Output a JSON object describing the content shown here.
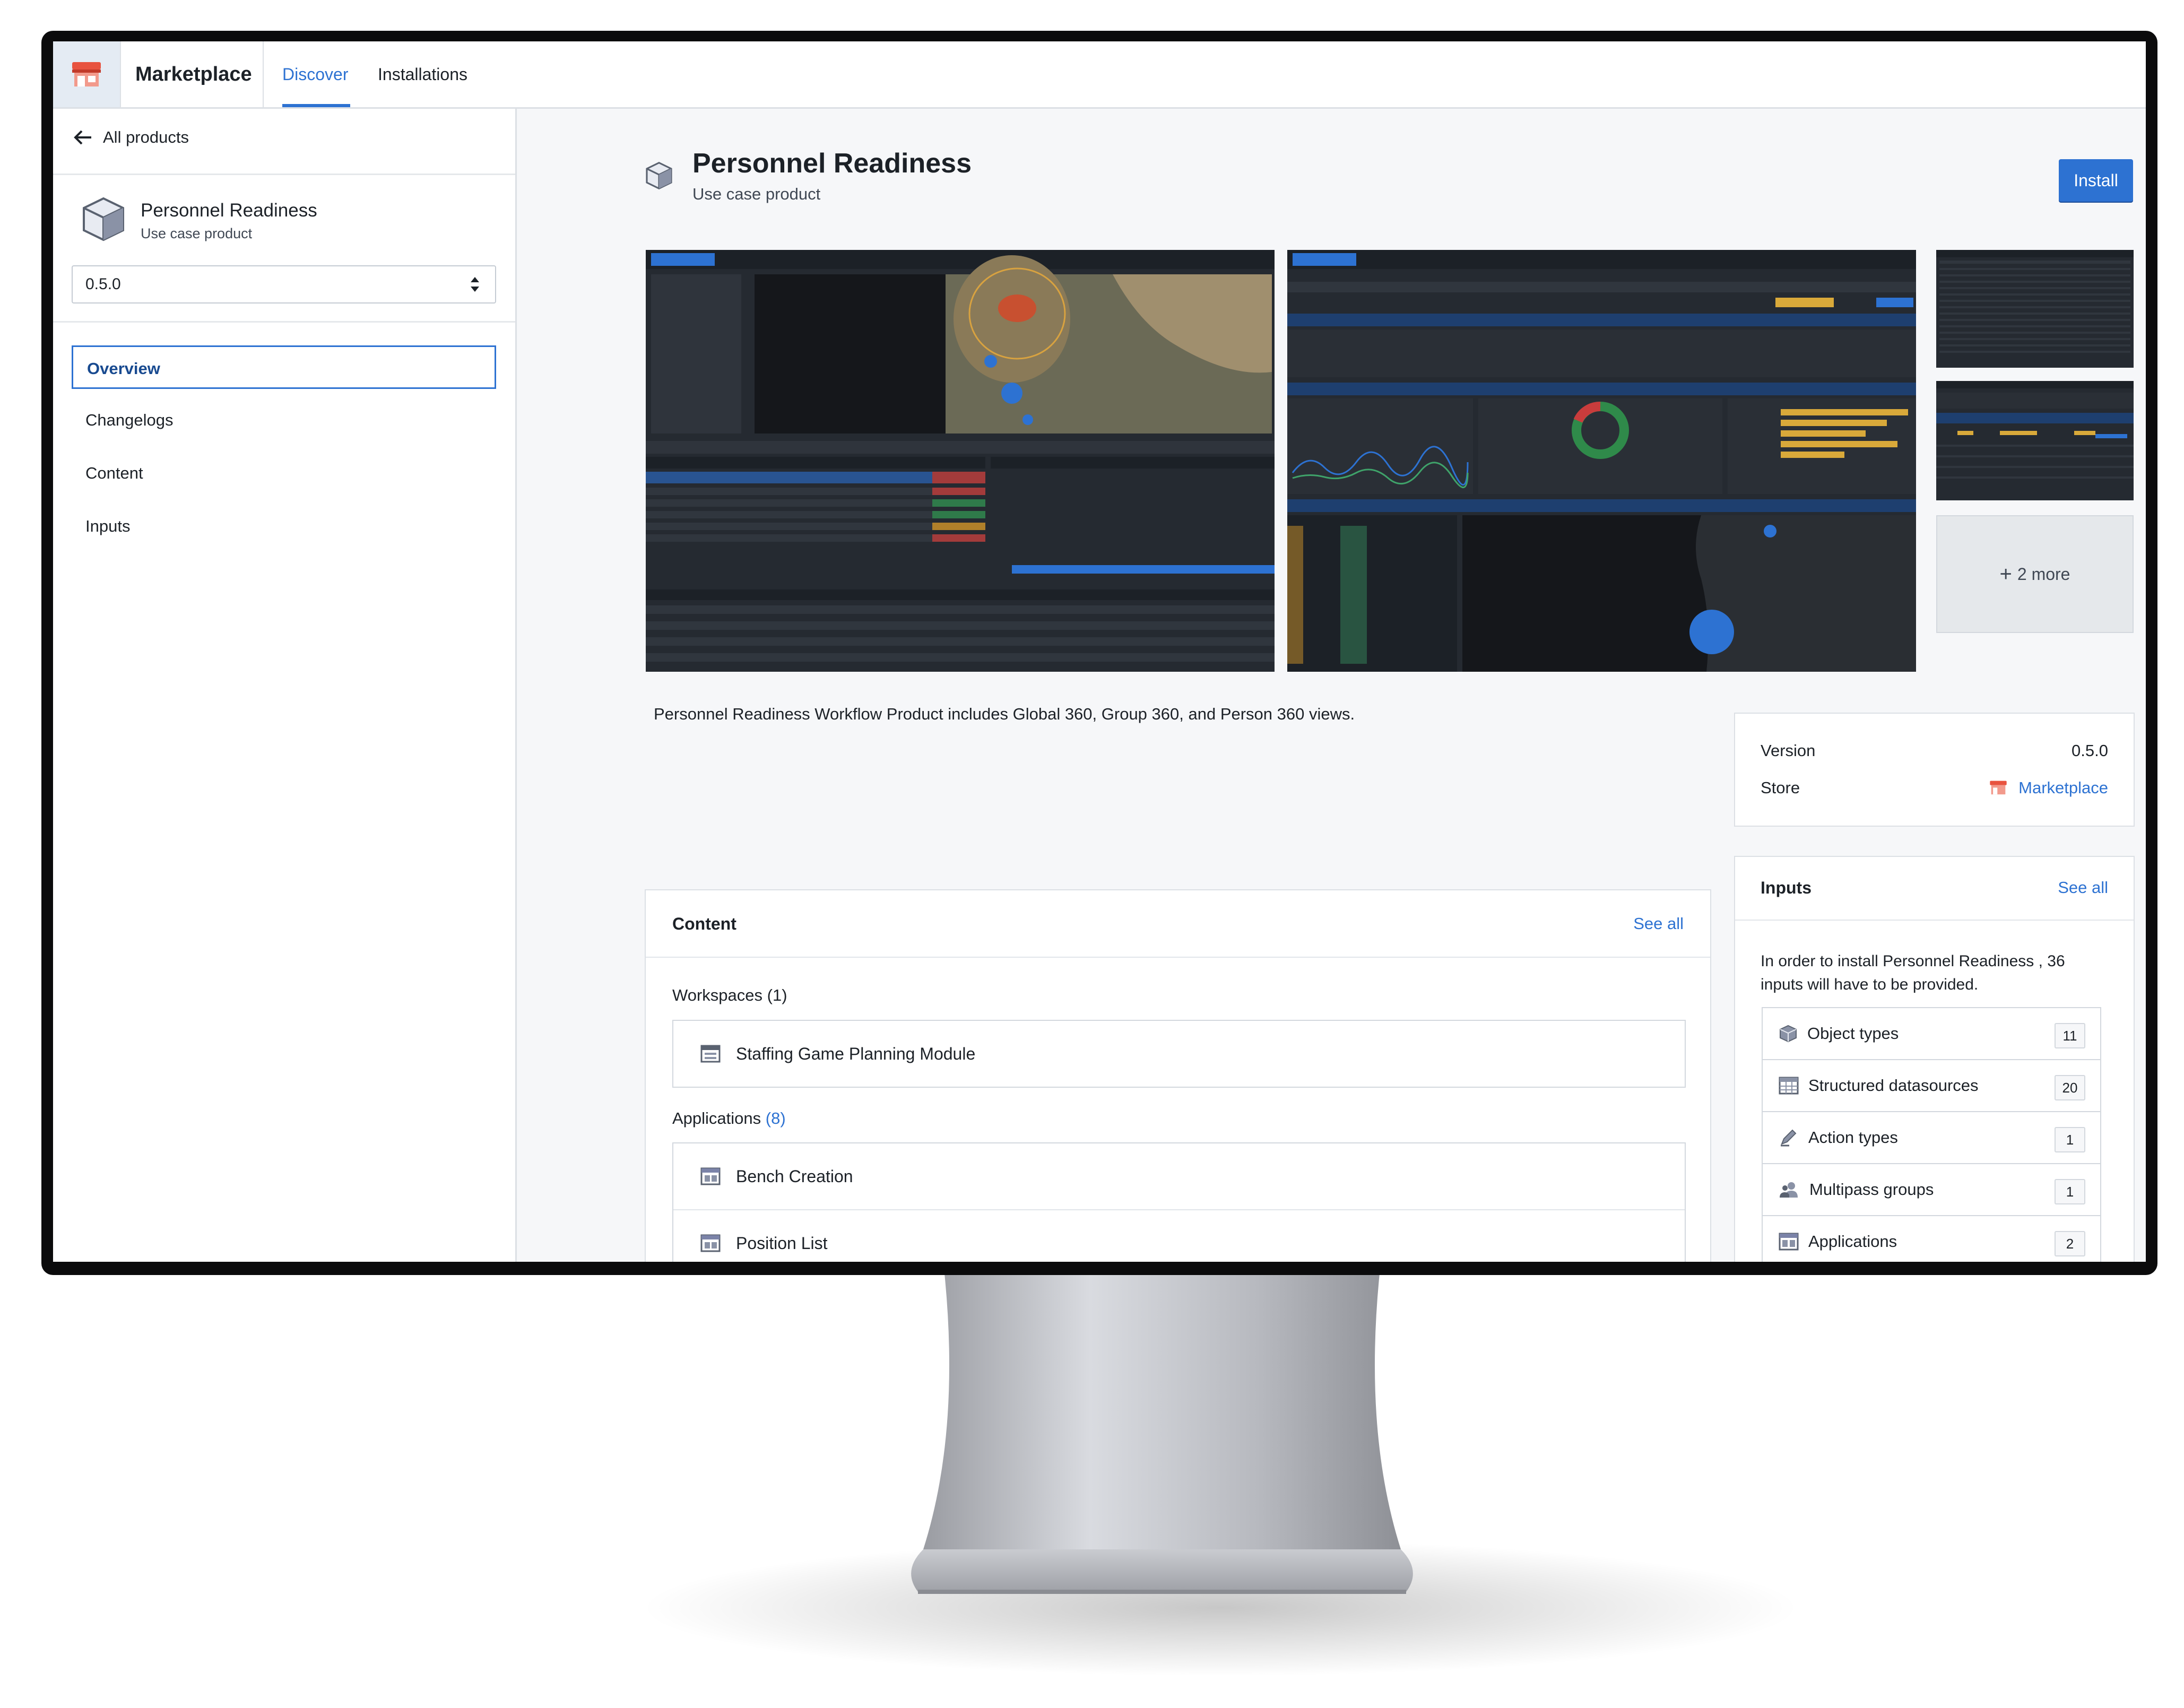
{
  "app": {
    "name": "Marketplace",
    "tabs": [
      {
        "label": "Discover",
        "active": true
      },
      {
        "label": "Installations",
        "active": false
      }
    ],
    "accent_color": "#2d72d2"
  },
  "sidebar": {
    "back_label": "All products",
    "product_name": "Personnel Readiness",
    "product_type": "Use case product",
    "version_selected": "0.5.0",
    "nav": [
      {
        "label": "Overview",
        "active": true
      },
      {
        "label": "Changelogs",
        "active": false
      },
      {
        "label": "Content",
        "active": false
      },
      {
        "label": "Inputs",
        "active": false
      }
    ]
  },
  "header": {
    "title": "Personnel Readiness",
    "subtitle": "Use case product",
    "install_label": "Install"
  },
  "gallery": {
    "more_label": "2 more"
  },
  "description": "Personnel Readiness Workflow Product includes Global 360, Group 360, and Person 360 views.",
  "details": {
    "version_label": "Version",
    "version_value": "0.5.0",
    "store_label": "Store",
    "store_value": "Marketplace"
  },
  "content": {
    "title": "Content",
    "see_all": "See all",
    "workspaces_label": "Workspaces",
    "workspaces_count": "(1)",
    "workspaces": [
      "Staffing Game Planning Module"
    ],
    "applications_label": "Applications",
    "applications_count": "(8)",
    "applications": [
      "Bench Creation",
      "Position List"
    ]
  },
  "inputs": {
    "title": "Inputs",
    "see_all": "See all",
    "intro": "In order to install Personnel Readiness , 36 inputs will have to be provided.",
    "items": [
      {
        "label": "Object types",
        "count": "11",
        "icon": "cube-icon"
      },
      {
        "label": "Structured datasources",
        "count": "20",
        "icon": "table-icon"
      },
      {
        "label": "Action types",
        "count": "1",
        "icon": "edit-icon"
      },
      {
        "label": "Multipass groups",
        "count": "1",
        "icon": "people-icon"
      },
      {
        "label": "Applications",
        "count": "2",
        "icon": "application-icon"
      }
    ]
  }
}
